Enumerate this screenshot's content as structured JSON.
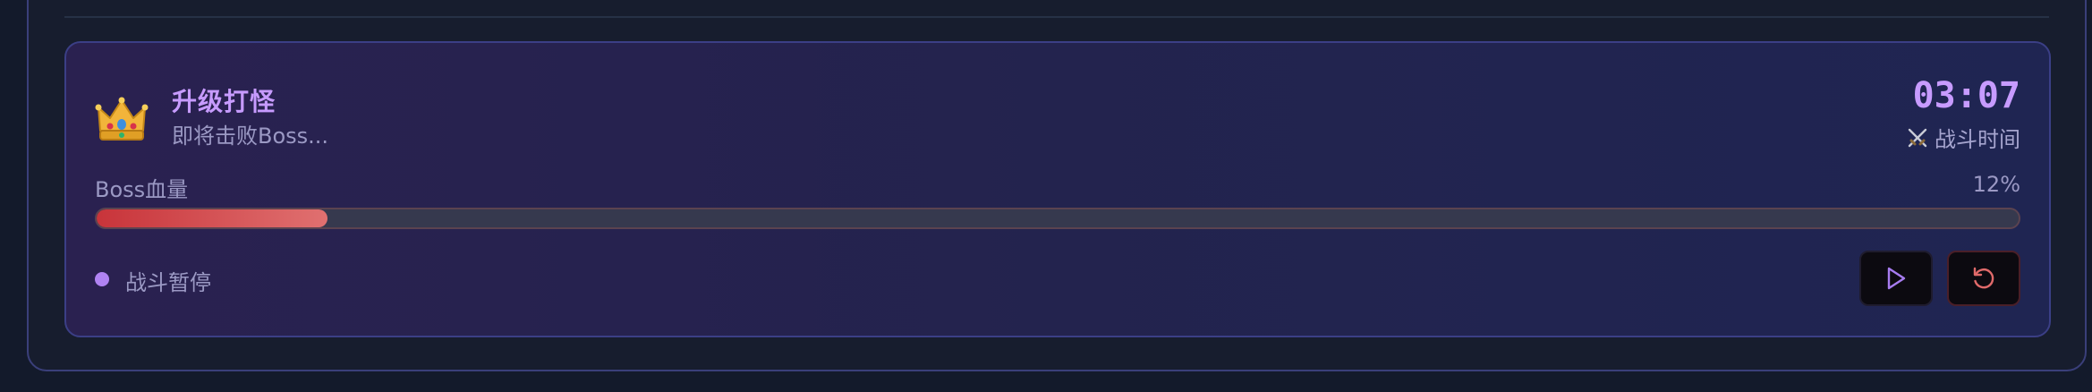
{
  "card": {
    "title": "升级打怪",
    "subtitle": "即将击败Boss...",
    "icon": "crown-icon"
  },
  "timer": {
    "value": "03:07",
    "label": "战斗时间",
    "label_icon": "crossed-swords-icon"
  },
  "boss": {
    "hp_label": "Boss血量",
    "hp_percent_text": "12%",
    "hp_fraction": 0.12
  },
  "status": {
    "text": "战斗暂停"
  },
  "controls": {
    "play_icon": "play-icon",
    "reset_icon": "reset-icon"
  },
  "colors": {
    "accent": "#c79bff",
    "hp_fill_start": "#c8343a",
    "hp_fill_end": "#e07070",
    "status_dot": "#b083f2",
    "reset_icon": "#e06a6a"
  }
}
